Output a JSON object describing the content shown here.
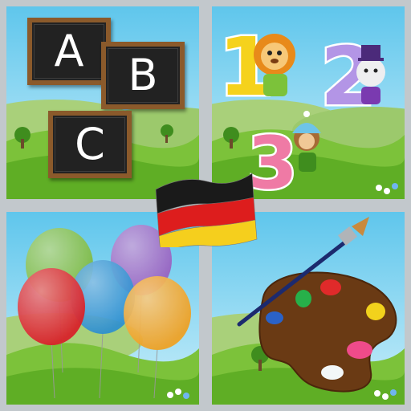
{
  "tiles": {
    "abc": {
      "letters": [
        "A",
        "B",
        "C"
      ]
    },
    "numbers": {
      "digits": [
        "1",
        "2",
        "3"
      ]
    },
    "balloons": {
      "colors": [
        "#7fba3a",
        "#9b5fc0",
        "#d8232a",
        "#2d8fd0",
        "#f0a020"
      ]
    },
    "paint": {
      "paint_colors": [
        "#2a62c8",
        "#27b04a",
        "#e02a2a",
        "#f2d21c",
        "#ef4b8a"
      ]
    }
  },
  "flag": {
    "language": "German",
    "colors": [
      "#1a1a1a",
      "#dd1d1d",
      "#f5cf1d"
    ]
  },
  "colors": {
    "sky": "#7fd2ef",
    "hills": "#6dbb2e",
    "chalkboard": "#222222",
    "frame": "#8b5a2b",
    "palette": "#6a3a14"
  }
}
